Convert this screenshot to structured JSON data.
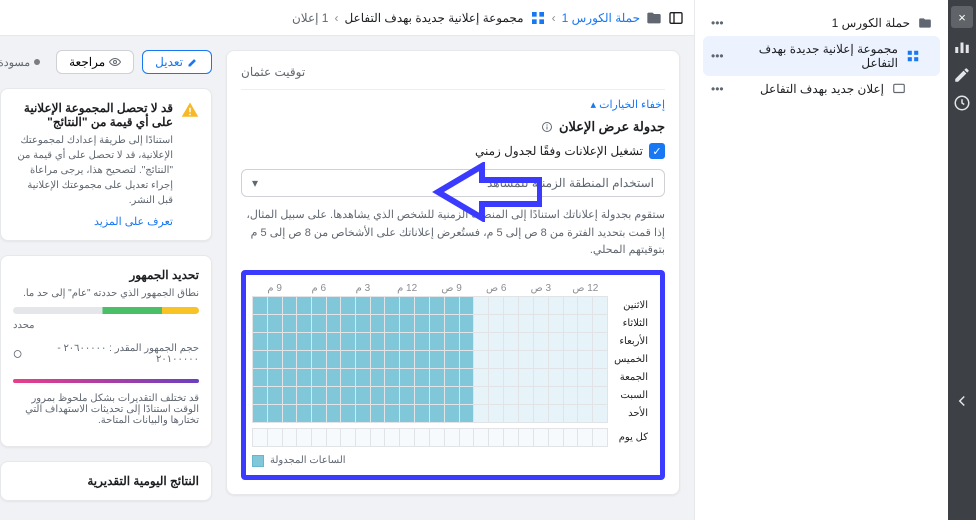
{
  "rail": {
    "close": "×"
  },
  "tree": {
    "campaign": "حملة الكورس 1",
    "adset": "مجموعة إعلانية جديدة بهدف التفاعل",
    "ad": "إعلان جديد بهدف التفاعل"
  },
  "crumbs": {
    "campaign": "حملة الكورس 1",
    "adset": "مجموعة إعلانية جديدة بهدف التفاعل",
    "adcount": "1 إعلان"
  },
  "topbar": {
    "edit": "تعديل",
    "review": "مراجعة",
    "draft": "مسودة"
  },
  "panel": {
    "time_title": "توقيت عثمان",
    "hide_options": "إخفاء الخيارات ▴",
    "section_title": "جدولة عرض الإعلان",
    "check_label": "تشغيل الإعلانات وفقًا لجدول زمني",
    "select_label": "استخدام المنطقة الزمنية للمشاهد",
    "help": "ستقوم بجدولة إعلاناتك استنادًا إلى المنطقة الزمنية للشخص الذي يشاهدها. على سبيل المثال، إذا قمت بتحديد الفترة من 8 ص إلى 5 م، فستُعرض إعلاناتك على الأشخاص من 8 ص إلى 5 م بتوقيتهم المحلي.",
    "legend": "الساعات المجدولة",
    "days": [
      "الاثنين",
      "الثلاثاء",
      "الأربعاء",
      "الخميس",
      "الجمعة",
      "السبت",
      "الأحد",
      "كل يوم"
    ],
    "hours": [
      "12 ص",
      "3 ص",
      "6 ص",
      "9 ص",
      "12 م",
      "3 م",
      "6 م",
      "9 م"
    ]
  },
  "side": {
    "warn_title": "قد لا تحصل المجموعة الإعلانية على أي قيمة من \"النتائج\"",
    "warn_body": "استنادًا إلى طريقة إعدادك لمجموعتك الإعلانية، قد لا تحصل على أي قيمة من \"النتائج\". لتصحيح هذا، يرجى مراعاة إجراء تعديل على مجموعتك الإعلانية قبل النشر.",
    "warn_link": "تعرف على المزيد",
    "aud_title": "تحديد الجمهور",
    "aud_sub": "نطاق الجمهور الذي حددته \"عام\" إلى حد ما.",
    "aud_scale": "محدد",
    "aud_num": "حجم الجمهور المقدر : ٢٠٦٠٠٠٠٠ - ٢٠١٠٠٠٠٠",
    "aud_foot": "قد تختلف التقديرات بشكل ملحوظ بمرور الوقت استنادًا إلى تحديثات الاستهداف التي تختارها والبيانات المتاحة.",
    "daily_title": "النتائج اليومية التقديرية"
  }
}
